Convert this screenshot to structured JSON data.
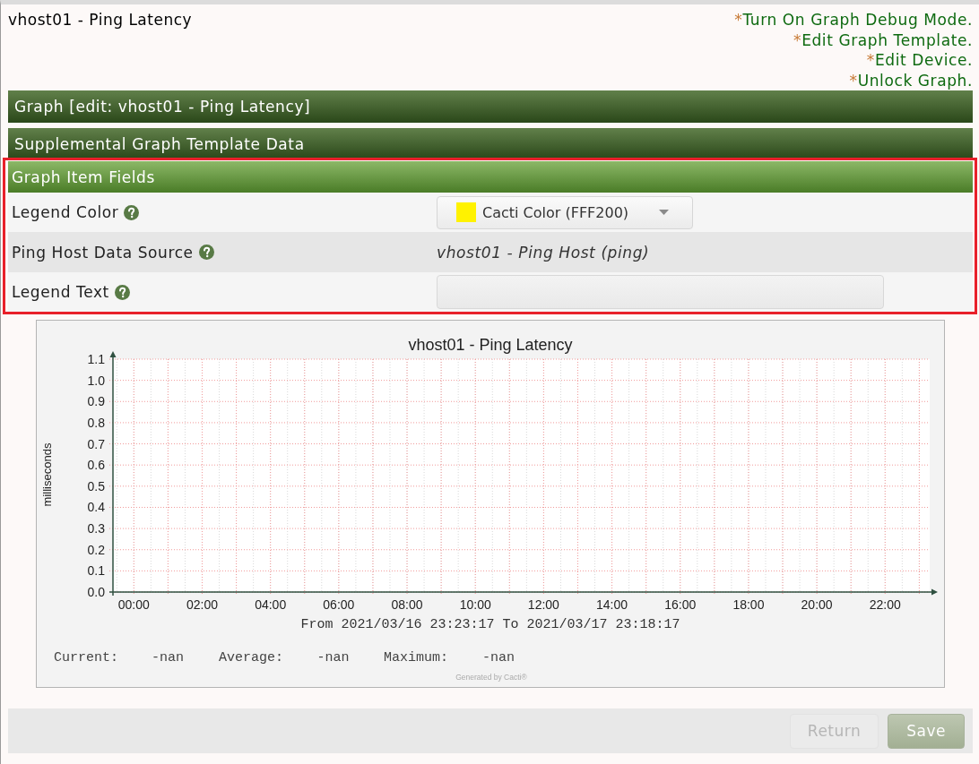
{
  "page": {
    "title": "vhost01 - Ping Latency"
  },
  "links": [
    {
      "marker": "*",
      "label": "Turn On Graph Debug Mode."
    },
    {
      "marker": "*",
      "label": "Edit Graph Template."
    },
    {
      "marker": "*",
      "label": "Edit Device."
    },
    {
      "marker": "*",
      "label": "Unlock Graph."
    }
  ],
  "panels": [
    {
      "kind": "section",
      "title": "Graph [edit: vhost01 - Ping Latency]"
    },
    {
      "kind": "section",
      "title": "Supplemental Graph Template Data"
    }
  ],
  "item_fields": {
    "title": "Graph Item Fields",
    "highlighted": true,
    "fields": [
      {
        "kind": "select",
        "label": "Legend Color",
        "value": "Cacti Color (FFF200)",
        "color": "#fff200"
      },
      {
        "kind": "static",
        "label": "Ping Host Data Source",
        "value": "vhost01 - Ping Host (ping)"
      },
      {
        "kind": "text",
        "label": "Legend Text"
      }
    ]
  },
  "graph": {
    "chart_data": {
      "type": "line",
      "title": "vhost01 - Ping Latency",
      "xlabel": "From 2021/03/16 23:23:17 To 2021/03/17 23:18:17",
      "ylabel": "milliseconds",
      "grid": true,
      "xlim": [
        -0.612,
        23.305
      ],
      "ylim": [
        0,
        1.1
      ],
      "xticks": [
        {
          "value": 0,
          "label": "00:00"
        },
        {
          "value": 2,
          "label": "02:00"
        },
        {
          "value": 4,
          "label": "04:00"
        },
        {
          "value": 6,
          "label": "06:00"
        },
        {
          "value": 8,
          "label": "08:00"
        },
        {
          "value": 10,
          "label": "10:00"
        },
        {
          "value": 12,
          "label": "12:00"
        },
        {
          "value": 14,
          "label": "14:00"
        },
        {
          "value": 16,
          "label": "16:00"
        },
        {
          "value": 18,
          "label": "18:00"
        },
        {
          "value": 20,
          "label": "20:00"
        },
        {
          "value": 22,
          "label": "22:00"
        }
      ],
      "yticks": [
        {
          "value": 0,
          "label": "0.0"
        },
        {
          "value": 0.1,
          "label": "0.1"
        },
        {
          "value": 0.2,
          "label": "0.2"
        },
        {
          "value": 0.3,
          "label": "0.3"
        },
        {
          "value": 0.4,
          "label": "0.4"
        },
        {
          "value": 0.5,
          "label": "0.5"
        },
        {
          "value": 0.6,
          "label": "0.6"
        },
        {
          "value": 0.7,
          "label": "0.7"
        },
        {
          "value": 0.8,
          "label": "0.8"
        },
        {
          "value": 0.9,
          "label": "0.9"
        },
        {
          "value": 1.0,
          "label": "1.0"
        },
        {
          "value": 1.1,
          "label": "1.1"
        }
      ]
    },
    "legend": [
      {
        "label": "Current:",
        "value": "-nan"
      },
      {
        "label": "Average:",
        "value": "-nan"
      },
      {
        "label": "Maximum:",
        "value": "-nan"
      }
    ],
    "credit": "Generated by Cacti®"
  },
  "buttons": [
    {
      "kind": "return",
      "label": "Return",
      "disabled": true
    },
    {
      "kind": "save",
      "label": "Save",
      "disabled": true
    }
  ]
}
